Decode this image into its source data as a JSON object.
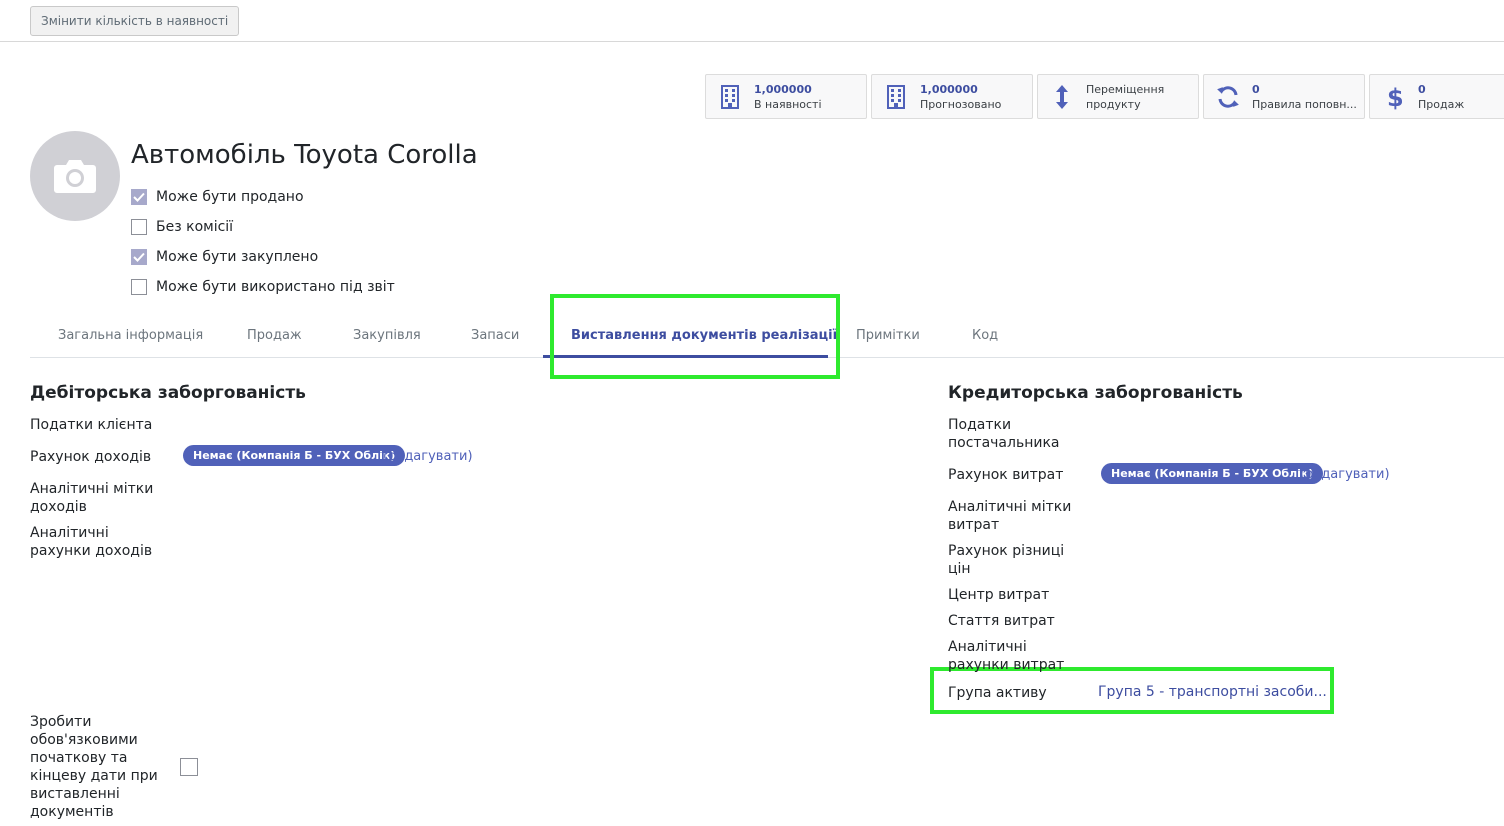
{
  "control_panel": {
    "update_qty_button": "Змінити кількість в наявності"
  },
  "smart_buttons": [
    {
      "icon": "building-icon",
      "value": "1,000000",
      "label": "В наявності"
    },
    {
      "icon": "building-icon",
      "value": "1,000000",
      "label": "Прогнозовано"
    },
    {
      "icon": "arrows-vertical-icon",
      "value": "Переміщення",
      "label": "продукту"
    },
    {
      "icon": "refresh-icon",
      "value": "0",
      "label": "Правила поповн..."
    },
    {
      "icon": "dollar-icon",
      "value": "0",
      "label": "Продаж"
    }
  ],
  "product": {
    "name": "Автомобіль Toyota Corolla",
    "checks": [
      {
        "label": "Може бути продано",
        "checked": true
      },
      {
        "label": "Без комісії",
        "checked": false
      },
      {
        "label": "Може бути закуплено",
        "checked": true
      },
      {
        "label": "Може бути використано під звіт",
        "checked": false
      }
    ]
  },
  "tabs": [
    {
      "label": "Загальна інформація",
      "active": false
    },
    {
      "label": "Продаж",
      "active": false
    },
    {
      "label": "Закупівля",
      "active": false
    },
    {
      "label": "Запаси",
      "active": false
    },
    {
      "label": "Виставлення документів реалізації",
      "active": true
    },
    {
      "label": "Примітки",
      "active": false
    },
    {
      "label": "Код",
      "active": false
    }
  ],
  "receivable": {
    "title": "Дебіторська заборгованість",
    "customer_taxes": "Податки клієнта",
    "income_account": "Рахунок доходів",
    "income_account_value": "Немає (Компанія Б - БУХ Облік)",
    "edit_link": "(редагувати)",
    "income_tags_1": "Аналітичні мітки",
    "income_tags_2": "доходів",
    "income_analytic_1": "Аналітичні",
    "income_analytic_2": "рахунки доходів",
    "mandatory_dates_lines": [
      "Зробити",
      "обов'язковими",
      "початкову та",
      "кінцеву дати при",
      "виставленні",
      "документів"
    ]
  },
  "payable": {
    "title": "Кредиторська заборгованість",
    "vendor_taxes_1": "Податки",
    "vendor_taxes_2": "постачальника",
    "expense_account": "Рахунок витрат",
    "expense_account_value": "Немає (Компанія Б - БУХ Облік)",
    "edit_link": "(редагувати)",
    "expense_tags_1": "Аналітичні мітки",
    "expense_tags_2": "витрат",
    "price_diff_1": "Рахунок різниці",
    "price_diff_2": "цін",
    "cost_center": "Центр витрат",
    "expense_item": "Стаття витрат",
    "expense_analytic_1": "Аналітичні",
    "expense_analytic_2": "рахунки витрат",
    "asset_group": "Група активу",
    "asset_group_value": "Група 5 - транспортні засоби..."
  },
  "colors": {
    "accent": "#3d4da0",
    "highlight": "#2eea2e",
    "badge": "#5061b9"
  }
}
